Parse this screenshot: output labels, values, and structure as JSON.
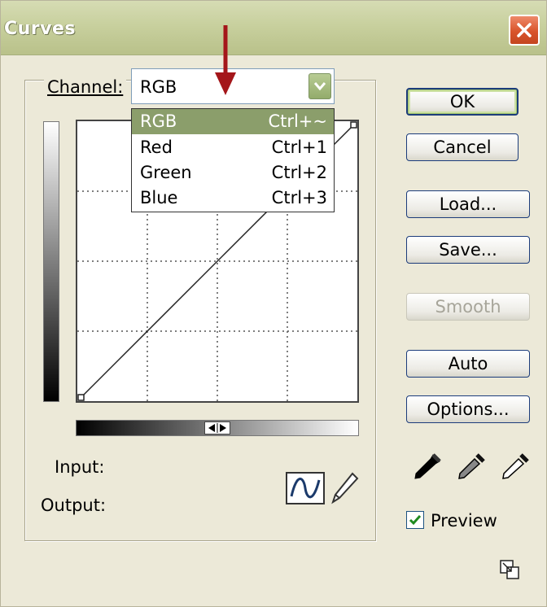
{
  "window": {
    "title": "Curves"
  },
  "channel": {
    "label": "Channel:",
    "selected": "RGB",
    "options": [
      {
        "label": "RGB",
        "shortcut": "Ctrl+~"
      },
      {
        "label": "Red",
        "shortcut": "Ctrl+1"
      },
      {
        "label": "Green",
        "shortcut": "Ctrl+2"
      },
      {
        "label": "Blue",
        "shortcut": "Ctrl+3"
      }
    ]
  },
  "buttons": {
    "ok": "OK",
    "cancel": "Cancel",
    "load": "Load...",
    "save": "Save...",
    "smooth": "Smooth",
    "auto": "Auto",
    "options": "Options..."
  },
  "fields": {
    "input_label": "Input:",
    "output_label": "Output:"
  },
  "preview": {
    "label": "Preview",
    "checked": true
  },
  "icons": {
    "close": "close-icon",
    "combo": "chevron-down-icon",
    "curve_tool": "curve-icon",
    "pencil_tool": "pencil-icon",
    "eyedroppers": [
      "black-eyedropper-icon",
      "gray-eyedropper-icon",
      "white-eyedropper-icon"
    ],
    "resize": "expand-icon",
    "annotation": "red-arrow"
  },
  "colors": {
    "selection": "#8b9e6b",
    "arrow": "#a4161a",
    "close": "#d9542b"
  }
}
